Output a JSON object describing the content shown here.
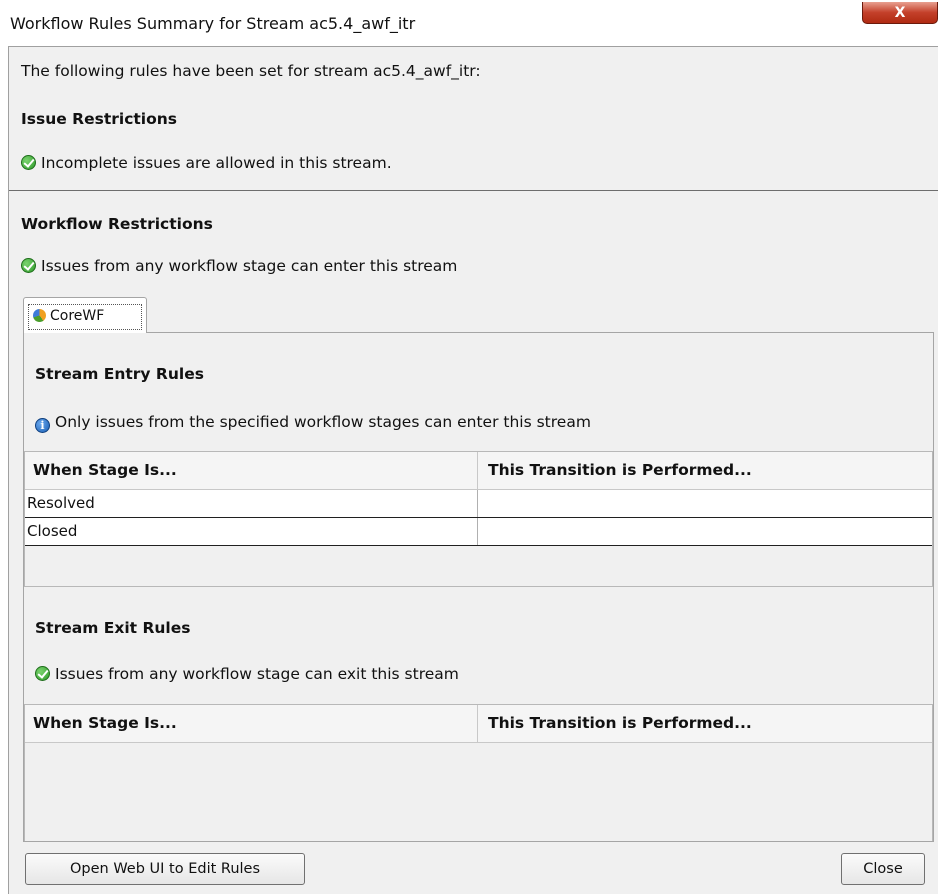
{
  "window": {
    "title": "Workflow Rules Summary for Stream ac5.4_awf_itr",
    "close_glyph": "X"
  },
  "intro": "The following rules have been set for stream ac5.4_awf_itr:",
  "issue_restrictions": {
    "heading": "Issue Restrictions",
    "status_icon": "check-circle-icon",
    "message": "Incomplete issues are allowed in this stream."
  },
  "workflow_restrictions": {
    "heading": "Workflow Restrictions",
    "status_icon": "check-circle-icon",
    "message": "Issues from any workflow stage can enter this stream"
  },
  "tabs": [
    {
      "label": "CoreWF",
      "icon": "workflow-icon",
      "selected": true
    }
  ],
  "entry_rules": {
    "heading": "Stream Entry Rules",
    "status_icon": "info-icon",
    "message": "Only issues from the specified workflow stages can enter this stream",
    "columns": [
      "When Stage Is...",
      "This Transition is Performed..."
    ],
    "rows": [
      [
        "Resolved",
        ""
      ],
      [
        "Closed",
        ""
      ]
    ]
  },
  "exit_rules": {
    "heading": "Stream Exit Rules",
    "status_icon": "check-circle-icon",
    "message": "Issues from any workflow stage can exit this stream",
    "columns": [
      "When Stage Is...",
      "This Transition is Performed..."
    ],
    "rows": []
  },
  "buttons": {
    "open_web_ui": "Open Web UI to Edit Rules",
    "close": "Close"
  },
  "colors": {
    "check_green": "#2f9a2a",
    "info_blue": "#1a5fb4",
    "close_red": "#c4402a"
  }
}
